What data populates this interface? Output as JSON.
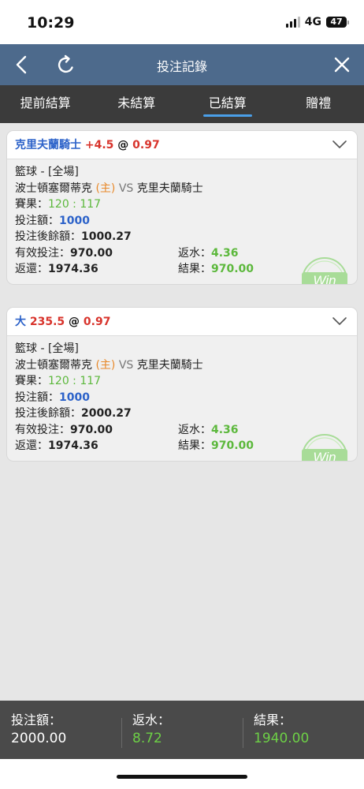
{
  "status_bar": {
    "time": "10:29",
    "network": "4G",
    "battery": "47"
  },
  "header": {
    "title": "投注記錄"
  },
  "tabs": [
    {
      "label": "提前結算",
      "active": false
    },
    {
      "label": "未結算",
      "active": false
    },
    {
      "label": "已結算",
      "active": true
    },
    {
      "label": "贈禮",
      "active": false
    }
  ],
  "bets": [
    {
      "selection": "克里夫蘭騎士",
      "line": "+4.5",
      "at": "@",
      "odds": "0.97",
      "sport": "籃球 - [全場]",
      "home_team": "波士頓塞爾蒂克",
      "home_tag": "(主)",
      "vs": "VS",
      "away_team": "克里夫蘭騎士",
      "score_label": "賽果：",
      "score": "120 : 117",
      "stake_label": "投注額：",
      "stake": "1000",
      "balance_label": "投注後餘額：",
      "balance": "1000.27",
      "valid_label": "有效投注：",
      "valid": "970.00",
      "rebate_label": "返水：",
      "rebate": "4.36",
      "return_label": "返還：",
      "return": "1974.36",
      "result_label": "結果：",
      "result": "970.00",
      "badge": "Win"
    },
    {
      "selection": "大",
      "line": "235.5",
      "at": "@",
      "odds": "0.97",
      "sport": "籃球 - [全場]",
      "home_team": "波士頓塞爾蒂克",
      "home_tag": "(主)",
      "vs": "VS",
      "away_team": "克里夫蘭騎士",
      "score_label": "賽果：",
      "score": "120 : 117",
      "stake_label": "投注額：",
      "stake": "1000",
      "balance_label": "投注後餘額：",
      "balance": "2000.27",
      "valid_label": "有效投注：",
      "valid": "970.00",
      "rebate_label": "返水：",
      "rebate": "4.36",
      "return_label": "返還：",
      "return": "1974.36",
      "result_label": "結果：",
      "result": "970.00",
      "badge": "Win"
    }
  ],
  "summary": {
    "stake_label": "投注額：",
    "stake": "2000.00",
    "rebate_label": "返水：",
    "rebate": "8.72",
    "result_label": "結果：",
    "result": "1940.00"
  },
  "colors": {
    "header": "#4d6a8c",
    "tabbar": "#3b3b3b",
    "accent": "#4a9fe8",
    "win_green": "#5cb83c",
    "loss_red": "#d8342c"
  }
}
